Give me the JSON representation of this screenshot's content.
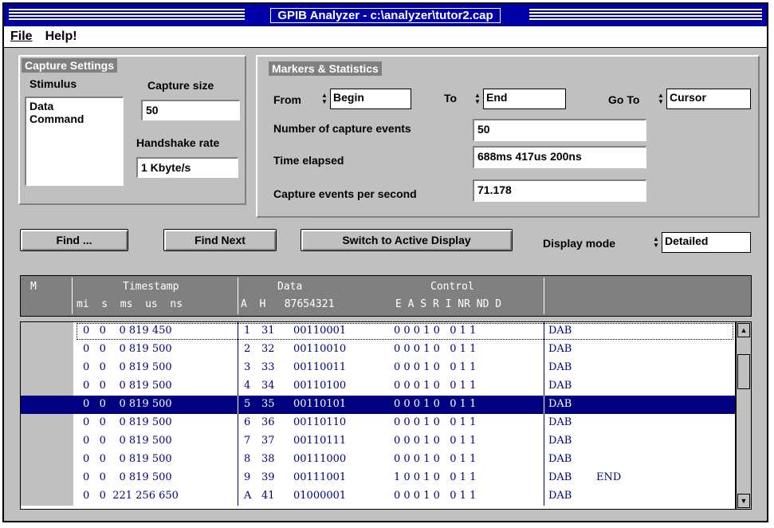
{
  "window": {
    "title": "GPIB Analyzer - c:\\analyzer\\tutor2.cap"
  },
  "menu": {
    "file": "File",
    "help": "Help!"
  },
  "capture_settings": {
    "title": "Capture Settings",
    "stimulus_label": "Stimulus",
    "stimulus_items": [
      "Data",
      "Command"
    ],
    "capture_size_label": "Capture size",
    "capture_size_value": "50",
    "handshake_label": "Handshake rate",
    "handshake_value": "1 Kbyte/s"
  },
  "markers": {
    "title": "Markers & Statistics",
    "from_label": "From",
    "from_value": "Begin",
    "to_label": "To",
    "to_value": "End",
    "goto_label": "Go To",
    "goto_value": "Cursor",
    "num_events_label": "Number of capture events",
    "num_events_value": "50",
    "time_label": "Time elapsed",
    "time_value": "688ms 417us 200ns",
    "eps_label": "Capture events per second",
    "eps_value": "71.178"
  },
  "toolbar": {
    "find": "Find ...",
    "find_next": "Find Next",
    "switch": "Switch to Active Display",
    "display_mode_label": "Display mode",
    "display_mode_value": "Detailed"
  },
  "table_header": {
    "m": "M",
    "timestamp": "Timestamp",
    "ts_sub": "mi  s  ms  us  ns",
    "data": "Data",
    "data_sub": "A  H   87654321",
    "control": "Control",
    "control_sub": "E A S R I NR ND D"
  },
  "rows": [
    {
      "ts": "0   0    0 819 450",
      "a": "1",
      "h": "31",
      "bits": "00110001",
      "ctrl": "0 0 0 1 0   0 1 1",
      "type": "DAB",
      "extra": ""
    },
    {
      "ts": "0   0    0 819 500",
      "a": "2",
      "h": "32",
      "bits": "00110010",
      "ctrl": "0 0 0 1 0   0 1 1",
      "type": "DAB",
      "extra": ""
    },
    {
      "ts": "0   0    0 819 500",
      "a": "3",
      "h": "33",
      "bits": "00110011",
      "ctrl": "0 0 0 1 0   0 1 1",
      "type": "DAB",
      "extra": ""
    },
    {
      "ts": "0   0    0 819 500",
      "a": "4",
      "h": "34",
      "bits": "00110100",
      "ctrl": "0 0 0 1 0   0 1 1",
      "type": "DAB",
      "extra": ""
    },
    {
      "ts": "0   0    0 819 500",
      "a": "5",
      "h": "35",
      "bits": "00110101",
      "ctrl": "0 0 0 1 0   0 1 1",
      "type": "DAB",
      "extra": ""
    },
    {
      "ts": "0   0    0 819 500",
      "a": "6",
      "h": "36",
      "bits": "00110110",
      "ctrl": "0 0 0 1 0   0 1 1",
      "type": "DAB",
      "extra": ""
    },
    {
      "ts": "0   0    0 819 500",
      "a": "7",
      "h": "37",
      "bits": "00110111",
      "ctrl": "0 0 0 1 0   0 1 1",
      "type": "DAB",
      "extra": ""
    },
    {
      "ts": "0   0    0 819 500",
      "a": "8",
      "h": "38",
      "bits": "00111000",
      "ctrl": "0 0 0 1 0   0 1 1",
      "type": "DAB",
      "extra": ""
    },
    {
      "ts": "0   0    0 819 500",
      "a": "9",
      "h": "39",
      "bits": "00111001",
      "ctrl": "1 0 0 1 0   0 1 1",
      "type": "DAB",
      "extra": "END"
    },
    {
      "ts": "0   0  221 256 650",
      "a": "A",
      "h": "41",
      "bits": "01000001",
      "ctrl": "0 0 0 1 0   0 1 1",
      "type": "DAB",
      "extra": ""
    }
  ],
  "selected_row": 4,
  "focused_row": 0,
  "icons": {
    "scroll_up": "scroll-up-arrow-icon",
    "scroll_down": "scroll-down-arrow-icon",
    "spinner": "spinner-arrows-icon"
  },
  "colors": {
    "title_bar": "#0000a8",
    "selection": "#000080",
    "panel": "#c0c0c0"
  }
}
